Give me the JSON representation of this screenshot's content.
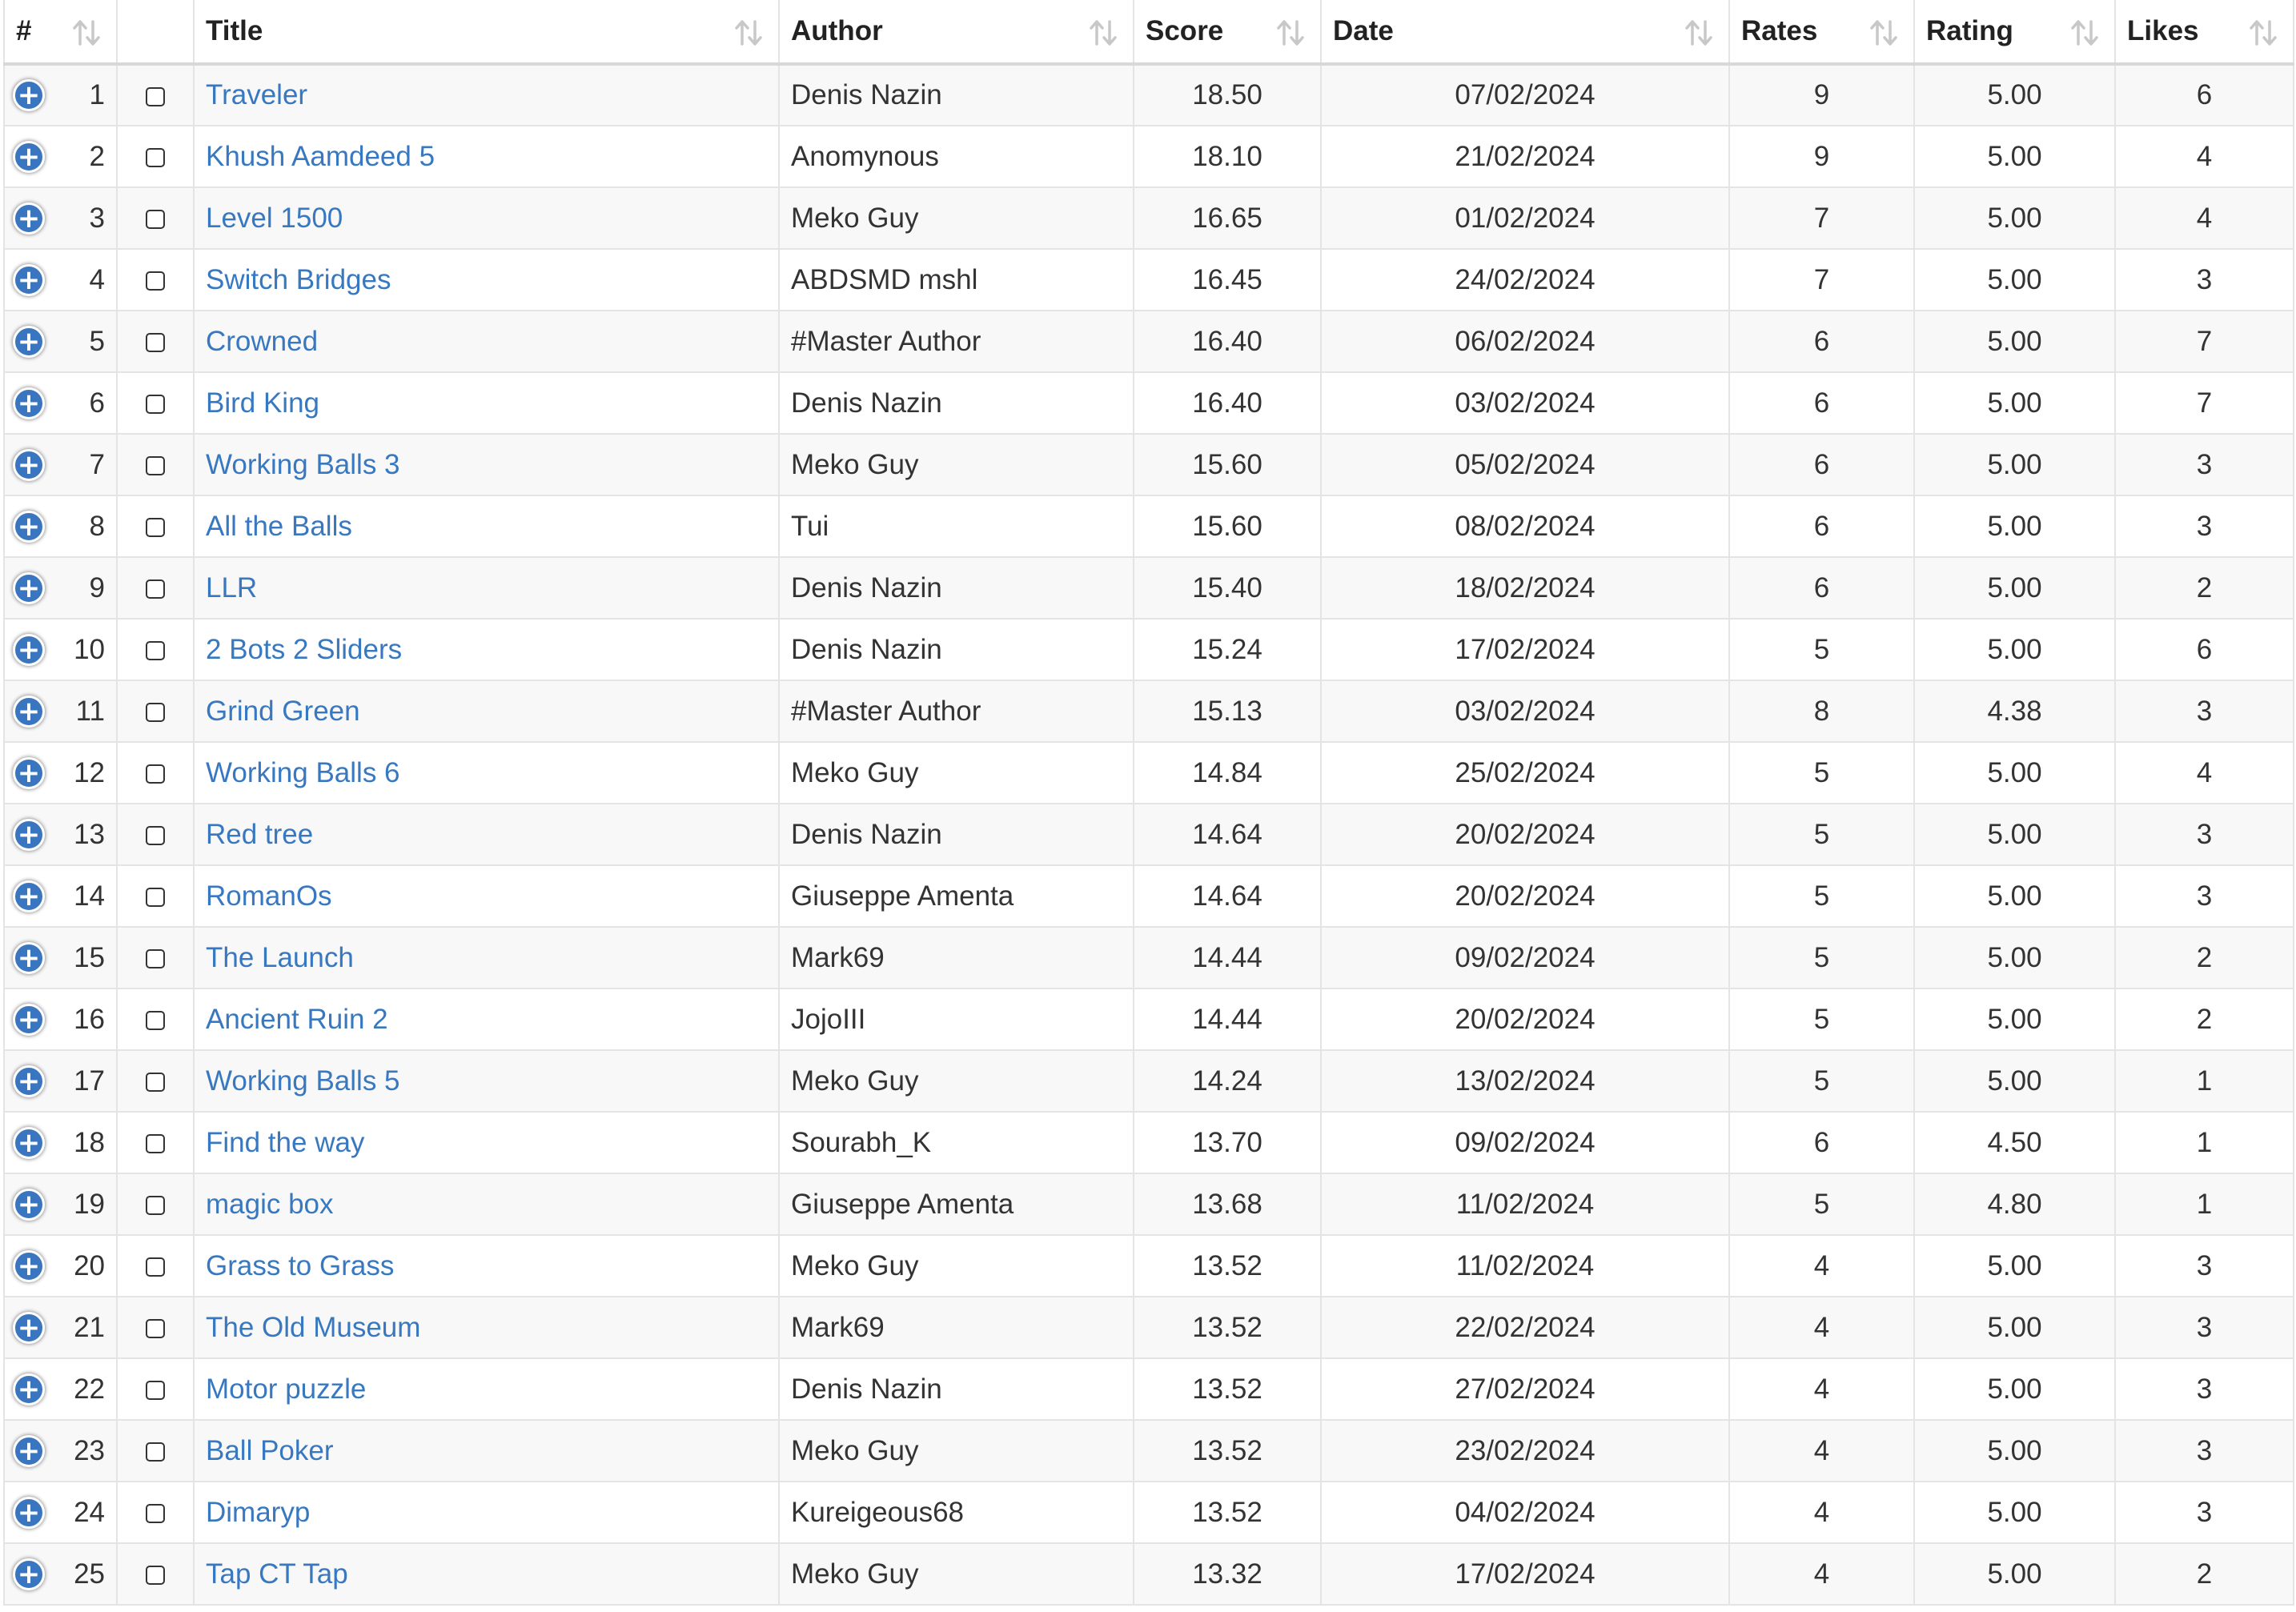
{
  "colors": {
    "link": "#3778c0",
    "expand_button": "#3a75bf",
    "row_stripe": "#f8f8f8",
    "border": "#e4e4e4"
  },
  "icons": {
    "expand": "plus-circle-icon",
    "sort": "sort-arrows-icon",
    "checkbox": "checkbox"
  },
  "columns": [
    {
      "key": "num",
      "label": "#"
    },
    {
      "key": "check",
      "label": ""
    },
    {
      "key": "title",
      "label": "Title"
    },
    {
      "key": "author",
      "label": "Author"
    },
    {
      "key": "score",
      "label": "Score"
    },
    {
      "key": "date",
      "label": "Date"
    },
    {
      "key": "rates",
      "label": "Rates"
    },
    {
      "key": "rating",
      "label": "Rating"
    },
    {
      "key": "likes",
      "label": "Likes"
    }
  ],
  "rows": [
    {
      "num": "1",
      "title": "Traveler",
      "author": "Denis Nazin",
      "score": "18.50",
      "date": "07/02/2024",
      "rates": "9",
      "rating": "5.00",
      "likes": "6"
    },
    {
      "num": "2",
      "title": "Khush Aamdeed 5",
      "author": "Anomynous",
      "score": "18.10",
      "date": "21/02/2024",
      "rates": "9",
      "rating": "5.00",
      "likes": "4"
    },
    {
      "num": "3",
      "title": "Level 1500",
      "author": "Meko Guy",
      "score": "16.65",
      "date": "01/02/2024",
      "rates": "7",
      "rating": "5.00",
      "likes": "4"
    },
    {
      "num": "4",
      "title": "Switch Bridges",
      "author": "ABDSMD mshl",
      "score": "16.45",
      "date": "24/02/2024",
      "rates": "7",
      "rating": "5.00",
      "likes": "3"
    },
    {
      "num": "5",
      "title": "Crowned",
      "author": "#Master Author",
      "score": "16.40",
      "date": "06/02/2024",
      "rates": "6",
      "rating": "5.00",
      "likes": "7"
    },
    {
      "num": "6",
      "title": "Bird King",
      "author": "Denis Nazin",
      "score": "16.40",
      "date": "03/02/2024",
      "rates": "6",
      "rating": "5.00",
      "likes": "7"
    },
    {
      "num": "7",
      "title": "Working Balls 3",
      "author": "Meko Guy",
      "score": "15.60",
      "date": "05/02/2024",
      "rates": "6",
      "rating": "5.00",
      "likes": "3"
    },
    {
      "num": "8",
      "title": "All the Balls",
      "author": "Tui",
      "score": "15.60",
      "date": "08/02/2024",
      "rates": "6",
      "rating": "5.00",
      "likes": "3"
    },
    {
      "num": "9",
      "title": "LLR",
      "author": "Denis Nazin",
      "score": "15.40",
      "date": "18/02/2024",
      "rates": "6",
      "rating": "5.00",
      "likes": "2"
    },
    {
      "num": "10",
      "title": "2 Bots 2 Sliders",
      "author": "Denis Nazin",
      "score": "15.24",
      "date": "17/02/2024",
      "rates": "5",
      "rating": "5.00",
      "likes": "6"
    },
    {
      "num": "11",
      "title": "Grind Green",
      "author": "#Master Author",
      "score": "15.13",
      "date": "03/02/2024",
      "rates": "8",
      "rating": "4.38",
      "likes": "3"
    },
    {
      "num": "12",
      "title": "Working Balls 6",
      "author": "Meko Guy",
      "score": "14.84",
      "date": "25/02/2024",
      "rates": "5",
      "rating": "5.00",
      "likes": "4"
    },
    {
      "num": "13",
      "title": "Red tree",
      "author": "Denis Nazin",
      "score": "14.64",
      "date": "20/02/2024",
      "rates": "5",
      "rating": "5.00",
      "likes": "3"
    },
    {
      "num": "14",
      "title": "RomanOs",
      "author": "Giuseppe Amenta",
      "score": "14.64",
      "date": "20/02/2024",
      "rates": "5",
      "rating": "5.00",
      "likes": "3"
    },
    {
      "num": "15",
      "title": "The Launch",
      "author": "Mark69",
      "score": "14.44",
      "date": "09/02/2024",
      "rates": "5",
      "rating": "5.00",
      "likes": "2"
    },
    {
      "num": "16",
      "title": "Ancient Ruin 2",
      "author": "JojoIII",
      "score": "14.44",
      "date": "20/02/2024",
      "rates": "5",
      "rating": "5.00",
      "likes": "2"
    },
    {
      "num": "17",
      "title": "Working Balls 5",
      "author": "Meko Guy",
      "score": "14.24",
      "date": "13/02/2024",
      "rates": "5",
      "rating": "5.00",
      "likes": "1"
    },
    {
      "num": "18",
      "title": "Find the way",
      "author": "Sourabh_K",
      "score": "13.70",
      "date": "09/02/2024",
      "rates": "6",
      "rating": "4.50",
      "likes": "1"
    },
    {
      "num": "19",
      "title": "magic box",
      "author": "Giuseppe Amenta",
      "score": "13.68",
      "date": "11/02/2024",
      "rates": "5",
      "rating": "4.80",
      "likes": "1"
    },
    {
      "num": "20",
      "title": "Grass to Grass",
      "author": "Meko Guy",
      "score": "13.52",
      "date": "11/02/2024",
      "rates": "4",
      "rating": "5.00",
      "likes": "3"
    },
    {
      "num": "21",
      "title": "The Old Museum",
      "author": "Mark69",
      "score": "13.52",
      "date": "22/02/2024",
      "rates": "4",
      "rating": "5.00",
      "likes": "3"
    },
    {
      "num": "22",
      "title": "Motor puzzle",
      "author": "Denis Nazin",
      "score": "13.52",
      "date": "27/02/2024",
      "rates": "4",
      "rating": "5.00",
      "likes": "3"
    },
    {
      "num": "23",
      "title": "Ball Poker",
      "author": "Meko Guy",
      "score": "13.52",
      "date": "23/02/2024",
      "rates": "4",
      "rating": "5.00",
      "likes": "3"
    },
    {
      "num": "24",
      "title": "Dimaryp",
      "author": "Kureigeous68",
      "score": "13.52",
      "date": "04/02/2024",
      "rates": "4",
      "rating": "5.00",
      "likes": "3"
    },
    {
      "num": "25",
      "title": "Tap CT Tap",
      "author": "Meko Guy",
      "score": "13.32",
      "date": "17/02/2024",
      "rates": "4",
      "rating": "5.00",
      "likes": "2"
    }
  ]
}
